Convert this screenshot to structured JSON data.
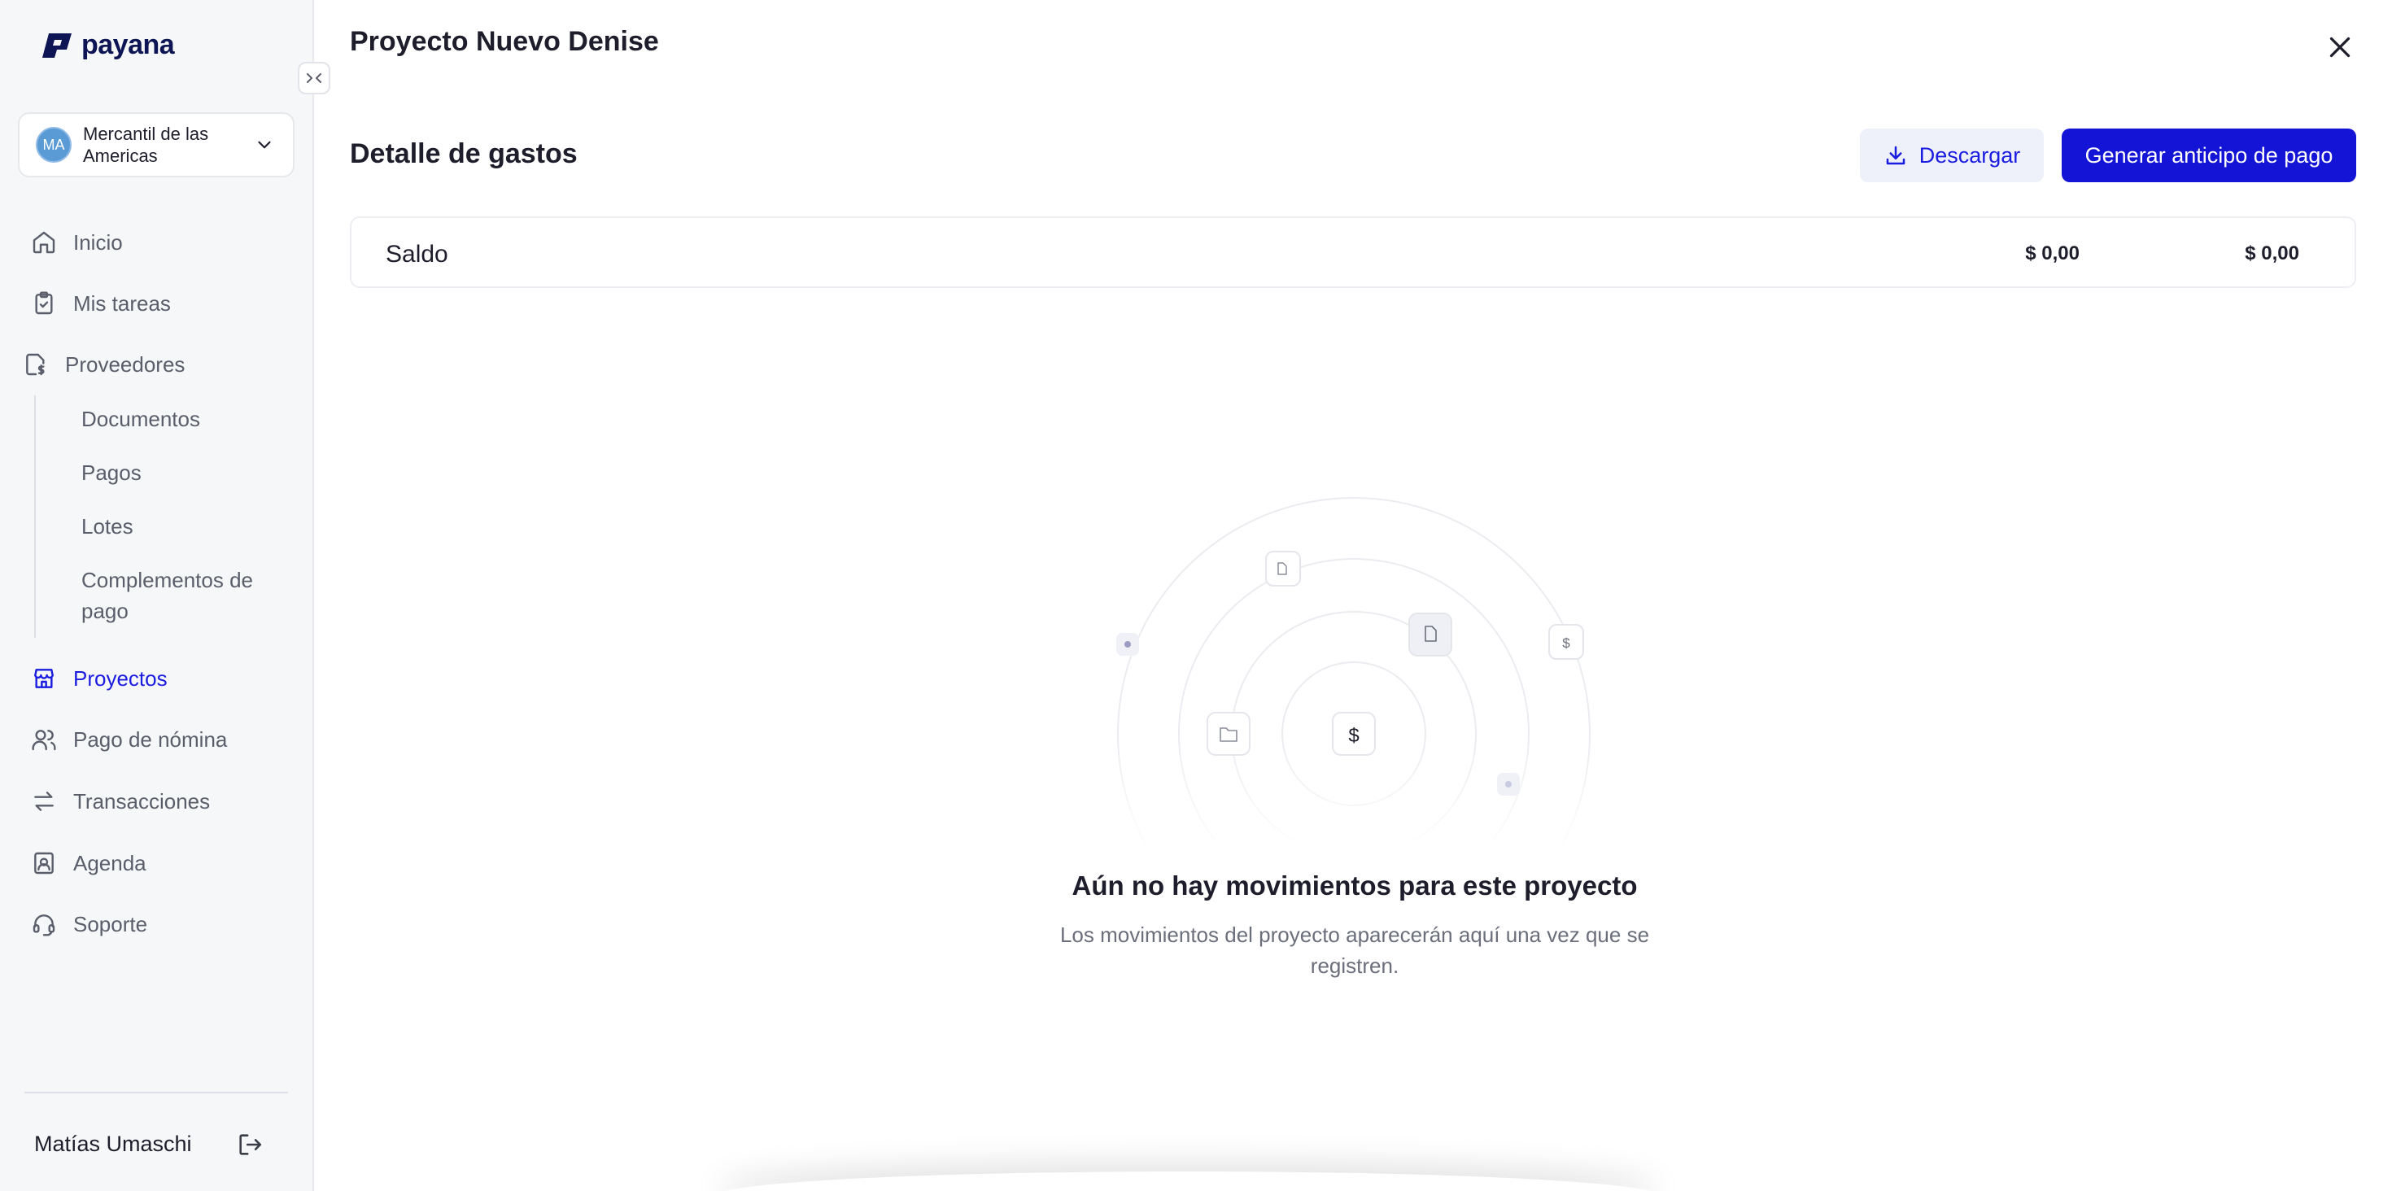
{
  "brand": {
    "name": "payana",
    "color": "#0d1554"
  },
  "org": {
    "initials": "MA",
    "name": "Mercantil de las Americas"
  },
  "nav": {
    "inicio": "Inicio",
    "tareas": "Mis tareas",
    "proveedores": "Proveedores",
    "sub": {
      "documentos": "Documentos",
      "pagos": "Pagos",
      "lotes": "Lotes",
      "complementos": "Complementos de pago"
    },
    "proyectos": "Proyectos",
    "nomina": "Pago de nómina",
    "transacciones": "Transacciones",
    "agenda": "Agenda",
    "soporte": "Soporte"
  },
  "user": {
    "name": "Matías Umaschi"
  },
  "header": {
    "title": "Proyecto Nuevo Denise"
  },
  "section": {
    "title": "Detalle de gastos",
    "download_label": "Descargar",
    "primary_label": "Generar anticipo de pago"
  },
  "saldo": {
    "label": "Saldo",
    "value_1": "$ 0,00",
    "value_2": "$ 0,00"
  },
  "empty": {
    "title": "Aún no hay movimientos para este proyecto",
    "description": "Los movimientos del proyecto aparecerán aquí una vez que se registren.",
    "center_symbol": "$",
    "orbit_symbol": "$"
  },
  "colors": {
    "accent": "#1414d6",
    "active_nav": "#1a1ce0"
  }
}
